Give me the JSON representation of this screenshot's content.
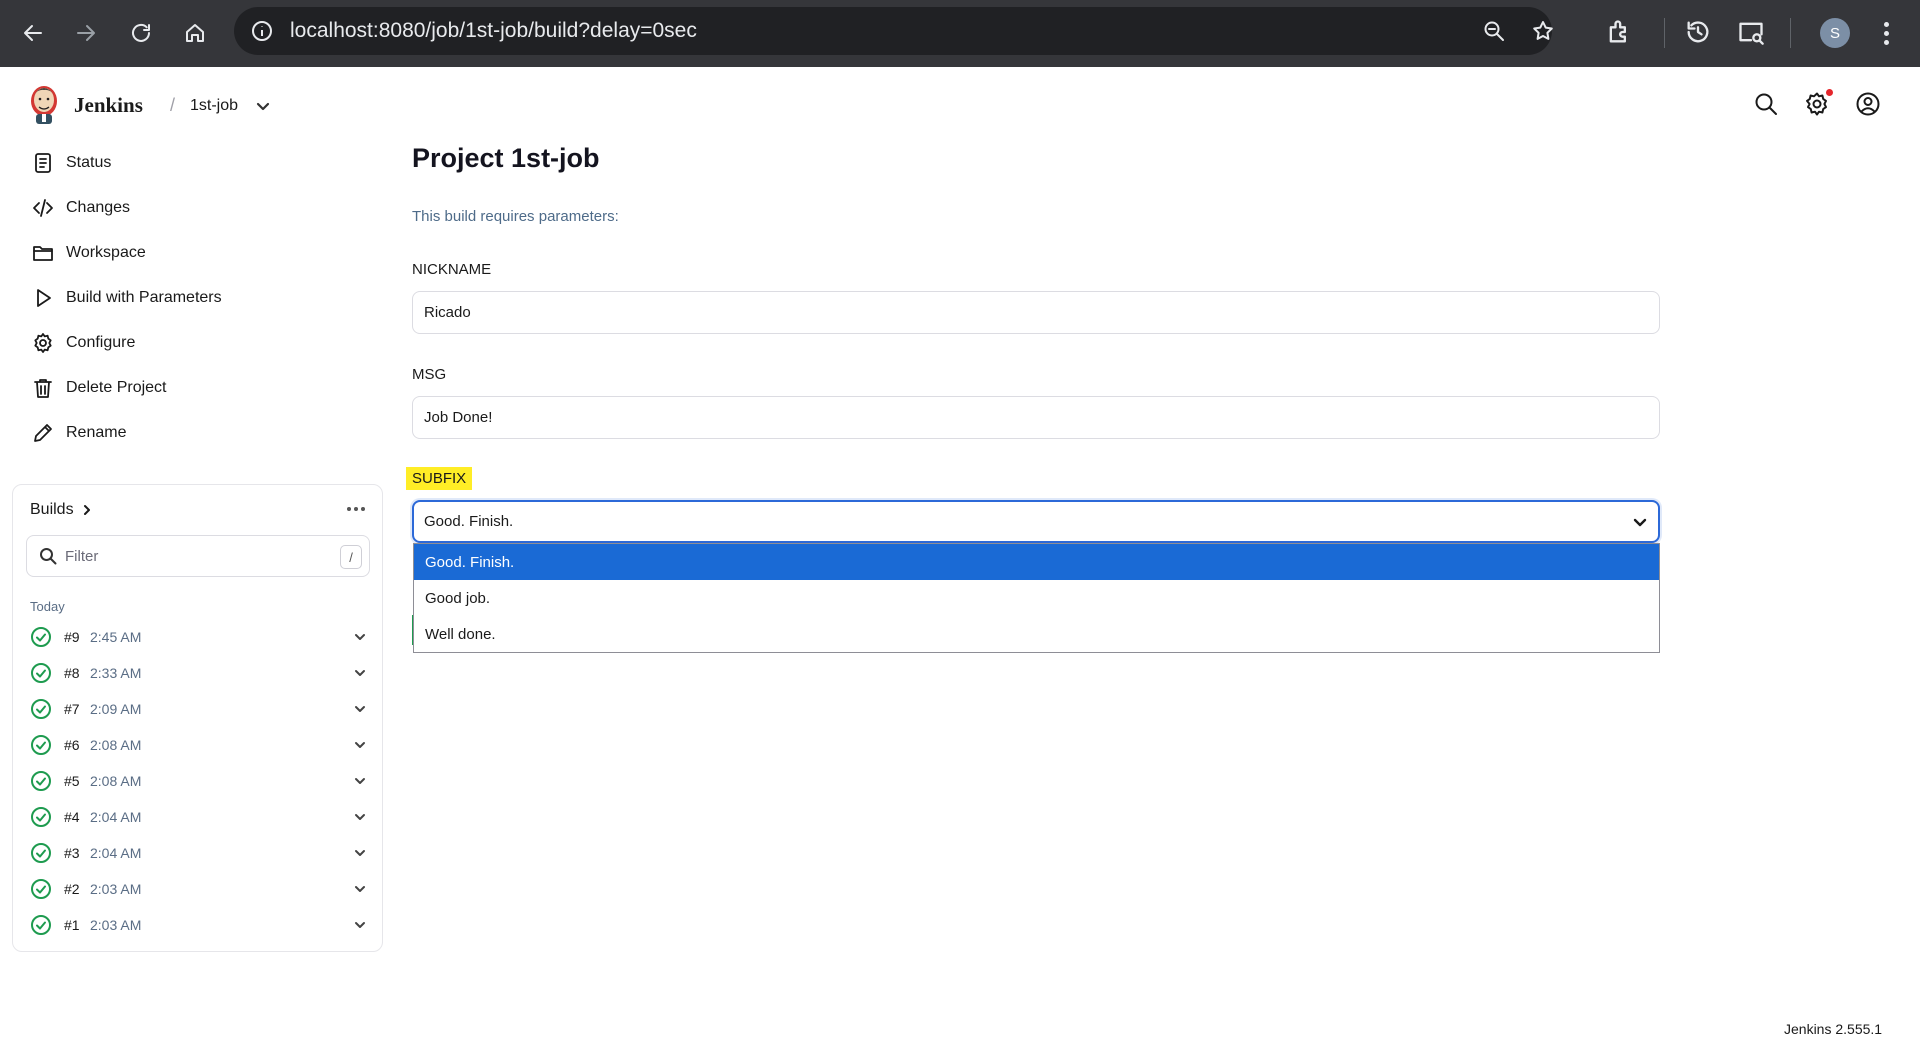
{
  "browser": {
    "url": "localhost:8080/job/1st-job/build?delay=0sec",
    "profile_initial": "S"
  },
  "header": {
    "brand": "Jenkins",
    "breadcrumb_job": "1st-job"
  },
  "sidebar": {
    "items": [
      {
        "label": "Status",
        "icon": "status-icon"
      },
      {
        "label": "Changes",
        "icon": "code-icon"
      },
      {
        "label": "Workspace",
        "icon": "folder-icon"
      },
      {
        "label": "Build with Parameters",
        "icon": "play-icon"
      },
      {
        "label": "Configure",
        "icon": "gear-icon"
      },
      {
        "label": "Delete Project",
        "icon": "trash-icon"
      },
      {
        "label": "Rename",
        "icon": "pencil-icon"
      }
    ]
  },
  "builds": {
    "title": "Builds",
    "filter_placeholder": "Filter",
    "filter_shortcut": "/",
    "group_label": "Today",
    "rows": [
      {
        "num": "#9",
        "time": "2:45 AM"
      },
      {
        "num": "#8",
        "time": "2:33 AM"
      },
      {
        "num": "#7",
        "time": "2:09 AM"
      },
      {
        "num": "#6",
        "time": "2:08 AM"
      },
      {
        "num": "#5",
        "time": "2:08 AM"
      },
      {
        "num": "#4",
        "time": "2:04 AM"
      },
      {
        "num": "#3",
        "time": "2:04 AM"
      },
      {
        "num": "#2",
        "time": "2:03 AM"
      },
      {
        "num": "#1",
        "time": "2:03 AM"
      }
    ]
  },
  "main": {
    "title": "Project 1st-job",
    "description": "This build requires parameters:",
    "params": {
      "nickname_label": "NICKNAME",
      "nickname_value": "Ricado",
      "msg_label": "MSG",
      "msg_value": "Job Done!",
      "subfix_label": "SUBFIX",
      "subfix_value": "Good. Finish.",
      "subfix_options": [
        "Good. Finish.",
        "Good job.",
        "Well done."
      ]
    }
  },
  "footer": {
    "version": "Jenkins 2.555.1"
  },
  "colors": {
    "accent": "#2c69d8",
    "selected_option": "#1a6ad5",
    "success": "#1e9b4f",
    "highlight": "#ffed26"
  }
}
